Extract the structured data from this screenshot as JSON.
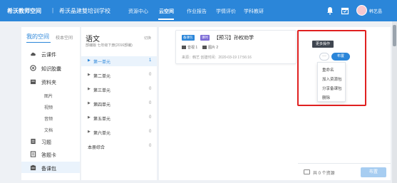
{
  "topbar": {
    "brand": "希沃教师空间",
    "school": "希沃晶建雙培训学校",
    "nav": [
      {
        "label": "资源中心"
      },
      {
        "label": "云空间"
      },
      {
        "label": "作业报告"
      },
      {
        "label": "学情评价"
      },
      {
        "label": "学科教研"
      }
    ],
    "username": "韩艺晶"
  },
  "sidebar": {
    "tab_mine": "我的空间",
    "tab_school": "校本空间",
    "items": [
      {
        "label": "云课件",
        "icon": "cloud-icon"
      },
      {
        "label": "知识胶囊",
        "icon": "capsule-icon"
      },
      {
        "label": "资料夹",
        "icon": "folder-icon"
      },
      {
        "label": "习题",
        "icon": "exercise-icon"
      },
      {
        "label": "答题卡",
        "icon": "answer-card-icon"
      },
      {
        "label": "备课包",
        "icon": "package-icon"
      }
    ],
    "subitems": [
      "图片",
      "视频",
      "音频",
      "文档"
    ]
  },
  "chapters": {
    "title": "语文",
    "switch": "切换",
    "subtitle": "部编版 七年级下册(2016部编)",
    "rows": [
      {
        "name": "第一单元",
        "count": "1"
      },
      {
        "name": "第二单元",
        "count": "0"
      },
      {
        "name": "第三单元",
        "count": "0"
      },
      {
        "name": "第四单元",
        "count": "0"
      },
      {
        "name": "第五单元",
        "count": "0"
      },
      {
        "name": "第六单元",
        "count": "0"
      },
      {
        "name": "本册综合",
        "count": "0"
      }
    ]
  },
  "card": {
    "badge1": "备课包",
    "badge2": "课时",
    "title": "【预习】孙权劝学",
    "meta1": "音视 1",
    "meta2": "图片 2",
    "dateline": "来源：韩艺   创建时间：2020-03-19 17:56:16"
  },
  "ops": {
    "tooltip": "更多操作",
    "more": "···",
    "layout_btn": "布置",
    "menu": [
      "重命名",
      "加入资源包",
      "分享备课包",
      "删除"
    ]
  },
  "bottombar": {
    "text": "共 0 个资源",
    "button": "布置"
  },
  "colors": {
    "brand": "#2b86d9",
    "highlight": "#e02020"
  }
}
